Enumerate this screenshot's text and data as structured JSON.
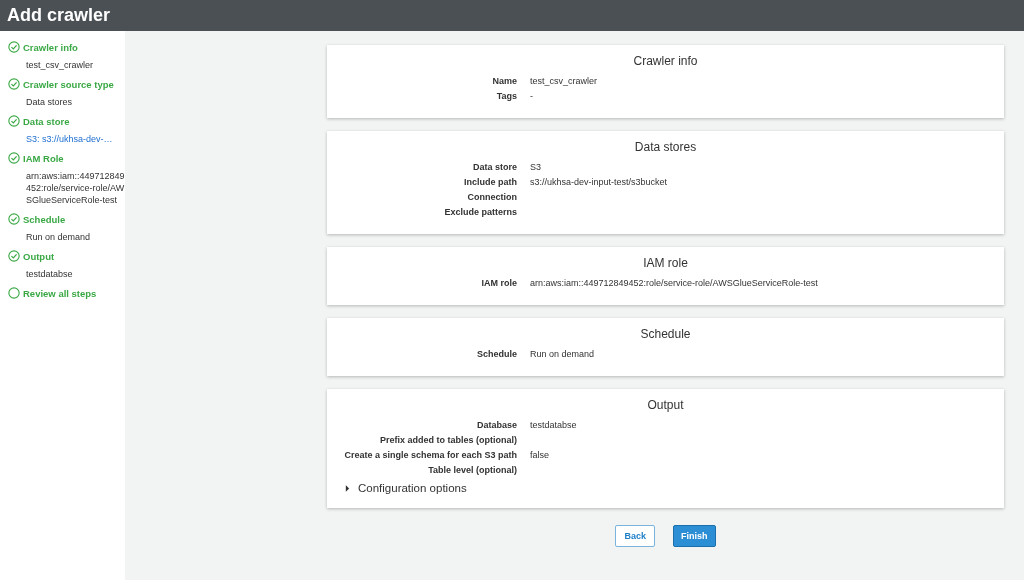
{
  "header": {
    "title": "Add crawler"
  },
  "steps": [
    {
      "label": "Crawler info",
      "done": true,
      "detail": {
        "text": "test_csv_crawler",
        "kind": "text"
      }
    },
    {
      "label": "Crawler source type",
      "done": true,
      "detail": {
        "text": "Data stores",
        "kind": "text"
      }
    },
    {
      "label": "Data store",
      "done": true,
      "detail": {
        "text": "S3: s3://ukhsa-dev-…",
        "kind": "link"
      }
    },
    {
      "label": "IAM Role",
      "done": true,
      "detail": {
        "text": "arn:aws:iam::449712849452:role/service-role/AWSGlueServiceRole-test",
        "kind": "text"
      }
    },
    {
      "label": "Schedule",
      "done": true,
      "detail": {
        "text": "Run on demand",
        "kind": "text"
      }
    },
    {
      "label": "Output",
      "done": true,
      "detail": {
        "text": "testdatabse",
        "kind": "text"
      }
    },
    {
      "label": "Review all steps",
      "done": false
    }
  ],
  "sections": [
    {
      "title": "Crawler info",
      "rows": [
        {
          "label": "Name",
          "value": "test_csv_crawler"
        },
        {
          "label": "Tags",
          "value": "-"
        }
      ]
    },
    {
      "title": "Data stores",
      "rows": [
        {
          "label": "Data store",
          "value": "S3"
        },
        {
          "label": "Include path",
          "value": "s3://ukhsa-dev-input-test/s3bucket"
        },
        {
          "label": "Connection"
        },
        {
          "label": "Exclude patterns"
        }
      ]
    },
    {
      "title": "IAM role",
      "rows": [
        {
          "label": "IAM role",
          "value": "arn:aws:iam::449712849452:role/service-role/AWSGlueServiceRole-test"
        }
      ]
    },
    {
      "title": "Schedule",
      "rows": [
        {
          "label": "Schedule",
          "value": "Run on demand"
        }
      ]
    },
    {
      "title": "Output",
      "rows": [
        {
          "label": "Database",
          "value": "testdatabse"
        },
        {
          "label": "Prefix added to tables (optional)"
        },
        {
          "label": "Create a single schema for each S3 path",
          "value": "false"
        },
        {
          "label": "Table level (optional)"
        }
      ],
      "expander": {
        "label": "Configuration options",
        "expanded": false
      }
    }
  ],
  "buttons": [
    {
      "label": "Back",
      "kind": "secondary"
    },
    {
      "label": "Finish",
      "kind": "primary"
    }
  ]
}
